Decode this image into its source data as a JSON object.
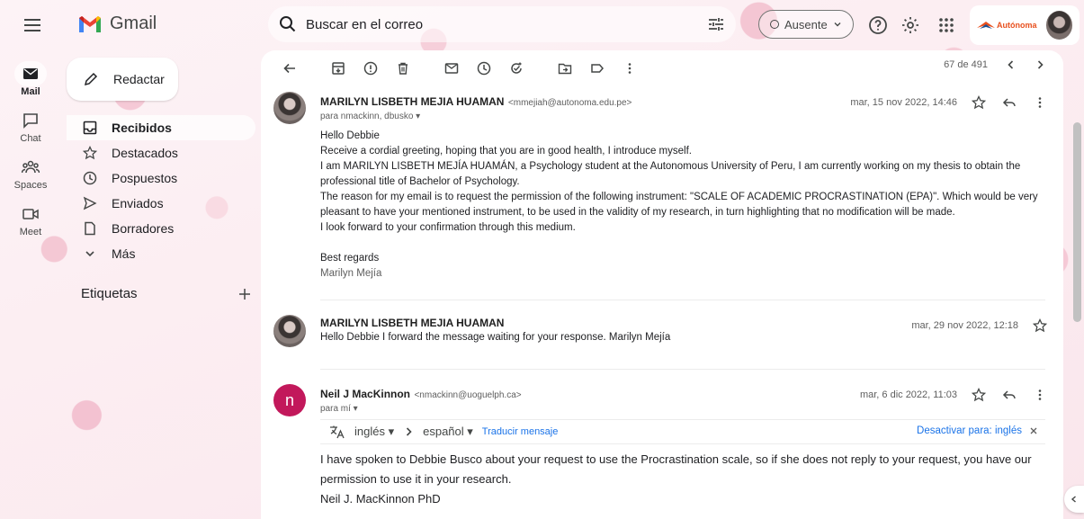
{
  "app": {
    "name": "Gmail"
  },
  "search": {
    "placeholder": "Buscar en el correo"
  },
  "status": {
    "label": "Ausente"
  },
  "account": {
    "org_label": "Autónoma"
  },
  "rail": [
    {
      "key": "mail",
      "label": "Mail"
    },
    {
      "key": "chat",
      "label": "Chat"
    },
    {
      "key": "spaces",
      "label": "Spaces"
    },
    {
      "key": "meet",
      "label": "Meet"
    }
  ],
  "compose": {
    "label": "Redactar"
  },
  "nav": [
    {
      "key": "inbox",
      "label": "Recibidos"
    },
    {
      "key": "starred",
      "label": "Destacados"
    },
    {
      "key": "snoozed",
      "label": "Pospuestos"
    },
    {
      "key": "sent",
      "label": "Enviados"
    },
    {
      "key": "drafts",
      "label": "Borradores"
    },
    {
      "key": "more",
      "label": "Más"
    }
  ],
  "labels": {
    "heading": "Etiquetas"
  },
  "pager": {
    "text": "67 de 491"
  },
  "messages": [
    {
      "sender": "MARILYN LISBETH MEJIA HUAMAN",
      "email": "<mmejiah@autonoma.edu.pe>",
      "to": "para nmackinn, dbusko",
      "date": "mar, 15 nov 2022, 14:46",
      "body": [
        "Hello Debbie",
        "Receive a cordial greeting, hoping that you are in good health, I introduce myself.",
        "I am MARILYN LISBETH MEJÍA HUAMÁN, a Psychology student at the Autonomous University of Peru, I am currently working on my thesis to obtain the professional title of Bachelor of Psychology.",
        "The reason for my email is to request the permission of the following instrument: \"SCALE OF ACADEMIC PROCRASTINATION (EPA)\". Which would be very pleasant to have your mentioned instrument, to be used in the validity of my research, in turn highlighting that no modification will be made.",
        "I look forward to your confirmation through this medium.",
        "",
        "Best regards",
        "Marilyn Mejía"
      ]
    },
    {
      "sender": "MARILYN LISBETH MEJIA HUAMAN",
      "date": "mar, 29 nov 2022, 12:18",
      "snippet": "Hello Debbie I forward the message waiting for your response. Marilyn Mejía"
    },
    {
      "sender": "Neil J MacKinnon",
      "email": "<nmackinn@uoguelph.ca>",
      "to": "para mí",
      "date": "mar, 6 dic 2022, 11:03",
      "avatar_letter": "n",
      "translate": {
        "from": "inglés",
        "to": "español",
        "action": "Traducir mensaje",
        "disable": "Desactivar para: inglés"
      },
      "body": [
        "I have spoken to Debbie Busco about your request to use the Procrastination scale, so if she does not reply to your request, you have our permission to use it in your research.",
        "Neil J. MacKinnon PhD"
      ]
    }
  ],
  "colors": {
    "accent": "#1a73e8",
    "avatar_n": "#c2185b"
  }
}
